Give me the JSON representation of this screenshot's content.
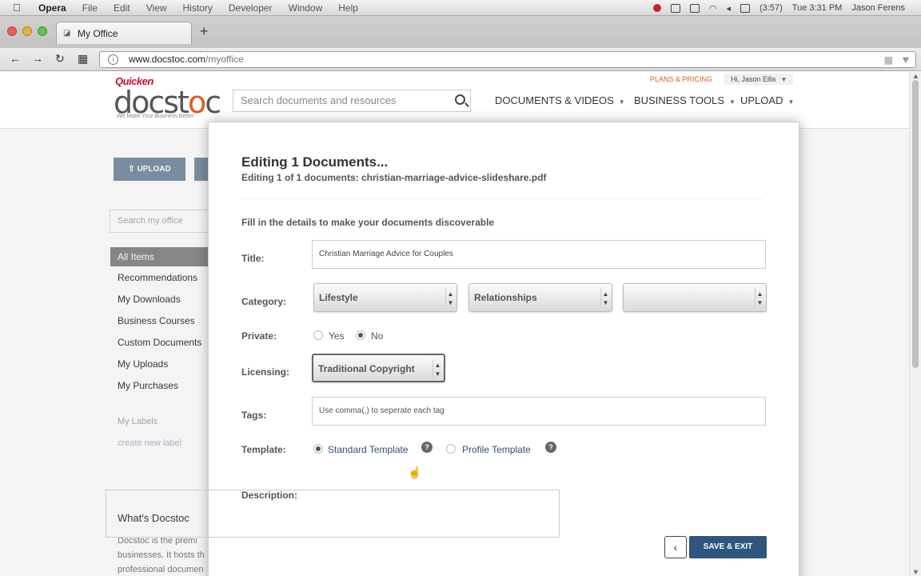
{
  "menubar": {
    "app": "Opera",
    "items": [
      "File",
      "Edit",
      "View",
      "History",
      "Developer",
      "Window",
      "Help"
    ],
    "clock": "Tue 3:31 PM",
    "user": "Jason Ferens",
    "battery": "(3:57)"
  },
  "browser": {
    "tab_title": "My Office",
    "url_host": "www.docstoc.com",
    "url_path": "/myoffice"
  },
  "site": {
    "brand_top": "Quicken",
    "brand_name_pre": "docst",
    "brand_name_o": "o",
    "brand_name_post": "c",
    "tagline": "We Make Your Business Better",
    "search_placeholder": "Search documents and resources",
    "nav": [
      "DOCUMENTS & VIDEOS",
      "BUSINESS TOOLS",
      "UPLOAD"
    ],
    "plans": "PLANS & PRICING",
    "hi_user": "Hi, Jason Ellis"
  },
  "left": {
    "upload_label": "⇧ UPLOAD",
    "search_placeholder": "Search my office",
    "all_items": "All Items",
    "links": [
      "Recommendations",
      "My Downloads",
      "Business Courses",
      "Custom Documents",
      "My Uploads",
      "My Purchases"
    ],
    "my_labels": "My Labels",
    "create_label": "create new label",
    "whats_title": "What's Docstoc",
    "whats_lines": [
      "Docstoc is the premi",
      "businesses. It hosts th",
      "professional documen"
    ]
  },
  "modal": {
    "title": "Editing 1 Documents...",
    "subtitle": "Editing 1 of 1 documents: christian-marriage-advice-slideshare.pdf",
    "fill_text": "Fill in the details to make your documents discoverable",
    "labels": {
      "title": "Title:",
      "category": "Category:",
      "private": "Private:",
      "licensing": "Licensing:",
      "tags": "Tags:",
      "template": "Template:",
      "description": "Description:"
    },
    "title_value": "Christian Marriage Advice for Couples",
    "category1": "Lifestyle",
    "category2": "Relationships",
    "category3": "",
    "private_yes": "Yes",
    "private_no": "No",
    "licensing_value": "Traditional Copyright",
    "tags_placeholder": "Use comma(,) to seperate each tag",
    "template_standard": "Standard Template",
    "template_profile": "Profile Template",
    "save_label": "SAVE & EXIT",
    "back_label": "‹"
  }
}
